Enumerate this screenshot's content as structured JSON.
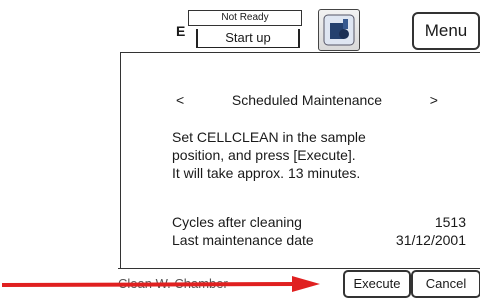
{
  "status": {
    "ready_text": "Not Ready",
    "mode_text": "Start up",
    "left_marker": "E"
  },
  "header": {
    "menu_label": "Menu",
    "instrument_icon": "analyzer-icon"
  },
  "navigation": {
    "prev": "<",
    "title": "Scheduled Maintenance",
    "next": ">"
  },
  "instructions": [
    "Set CELLCLEAN in the sample",
    "position, and press [Execute].",
    "It will take approx. 13 minutes."
  ],
  "info": {
    "cycles_label": "Cycles after cleaning",
    "cycles_value": "1513",
    "last_date_label": "Last maintenance date",
    "last_date_value": "31/12/2001"
  },
  "footer": {
    "hint": "Clean W. Chamber",
    "execute_label": "Execute",
    "cancel_label": "Cancel"
  },
  "colors": {
    "annotation_arrow": "#e02020"
  }
}
